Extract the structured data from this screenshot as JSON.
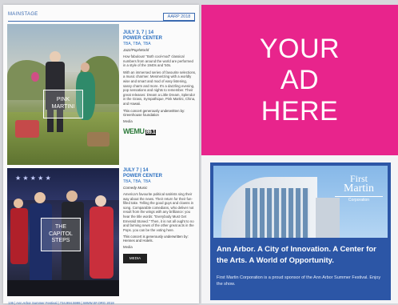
{
  "header": {
    "section": "MAINSTAGE",
    "tag": "AARP 2018"
  },
  "event1": {
    "photo_label_line1": "PINK",
    "photo_label_line2": "MARTINI",
    "date": "JULY 3, 7 | 14",
    "venue": "POWER CENTER",
    "times": "TBA, TBA, TBA",
    "category": "Jazz/Pop/World",
    "body": [
      "How fabulous! \"Both cool-mod\" classical numbers from around the world are performed in a style of the 1940s and '50s.",
      "With an immersed series of favourite selections, a music charmer. Mesmerizing with a worldly wise and smart and mod of easy listening, sassy charm and more. It's a dazzling evening, pop sensations and nights to remember. Their great releases: Dream a Little Dream, Splendor in the Grass, Sympathique, Pink Martini, China, and Hawaii."
    ],
    "sponsor": "This concert generously underwritten by: Greenhouse foundation",
    "media_label": "Media",
    "media_logo": "WEMU",
    "media_logo_num": "89.1"
  },
  "event2": {
    "photo_label_line1": "THE",
    "photo_label_line2": "CAPITOL",
    "photo_label_line3": "STEPS",
    "date": "JULY 7 | 14",
    "venue": "POWER CENTER",
    "times": "TBA, TBA, TBA",
    "category": "Comedy Music",
    "body": [
      "America's favourite political satirists sing their way about the news. Their return for their fun-filled take. Telling the good guys and clowns in song. Comparable comedians, who deliver not result from the wings with any brilliance: you hear the title words: \"Everybody Must Get Emerald Stoned.\" Then, it is not all ought to no and farming news of the other great acts in the Pops. you can be the voting here."
    ],
    "sponsor": "This concert is generously underwritten by: Hennes and Hotels.",
    "media_label": "Media",
    "media_logo": "MEDIA"
  },
  "footer": "136 | Ann Arbor Summer Festival | 734.994.5999 | WWW.SF.ORG 2018",
  "ad_pink": {
    "line1": "YOUR",
    "line2": "AD",
    "line3": "HERE"
  },
  "ad_blue": {
    "logo_first": "First",
    "logo_martin": "Martin",
    "logo_corp": "Corporation",
    "tagline": "Ann Arbor. A City of Innovation. A Center for the Arts. A World of Opportunity.",
    "subtag": "First Martin Corporation is a proud sponsor of the Ann Arbor Summer Festival. Enjoy the show."
  },
  "colors": {
    "accent_blue": "#2a6fc0",
    "ad_pink": "#e8248c",
    "ad_blue": "#2c56a6"
  }
}
